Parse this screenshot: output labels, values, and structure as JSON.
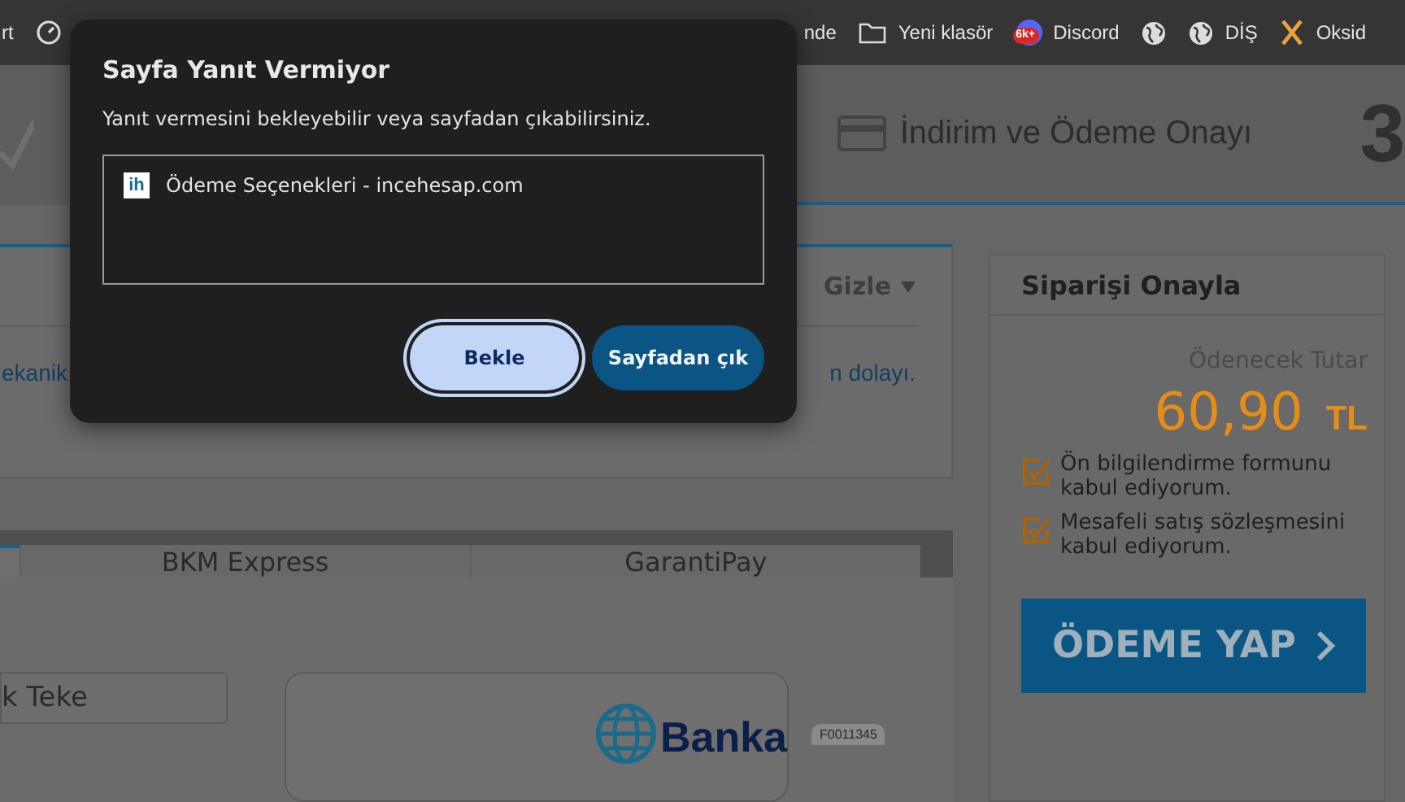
{
  "bookmarks_bar": {
    "items": [
      {
        "kind": "text",
        "label": "rt"
      },
      {
        "kind": "gauge"
      },
      {
        "kind": "text",
        "label": "nde"
      },
      {
        "kind": "folder",
        "label": "Yeni klasör"
      },
      {
        "kind": "discord",
        "label": "Discord",
        "badge": "6k+"
      },
      {
        "kind": "globe"
      },
      {
        "kind": "globe",
        "label": "DİŞ"
      },
      {
        "kind": "cross",
        "label": "Oksid"
      }
    ]
  },
  "step_header": {
    "label": "İndirim ve Ödeme Onayı",
    "number": "3"
  },
  "info_panel": {
    "toggle": "Gizle",
    "text_left": "ekanik",
    "text_right": "n dolayı."
  },
  "payment_tabs": [
    {
      "selected": true
    },
    {
      "label": "BKM Express",
      "selected": false
    },
    {
      "label": "GarantiPay",
      "selected": false
    }
  ],
  "name_field": {
    "value": "k Teke"
  },
  "card_image": {
    "brand": "Banka",
    "serial": "F0011345"
  },
  "order_summary": {
    "title": "Siparişi Onayla",
    "amount_label": "Ödenecek Tutar",
    "amount": "60,90",
    "currency": "TL",
    "agreements": [
      {
        "label": "Ön bilgilendirme formunu kabul ediyorum.",
        "checked": true
      },
      {
        "label": "Mesafeli satış sözleşmesini kabul ediyorum.",
        "checked": true
      }
    ],
    "pay_button": "ÖDEME YAP"
  },
  "dialog": {
    "title": "Sayfa Yanıt Vermiyor",
    "message": "Yanıt vermesini bekleyebilir veya sayfadan çıkabilirsiniz.",
    "page": {
      "favicon": "ih",
      "title": "Ödeme Seçenekleri - incehesap.com"
    },
    "buttons": [
      {
        "label": "Bekle",
        "kind": "secondary",
        "focused": true
      },
      {
        "label": "Sayfadan çık",
        "kind": "primary",
        "focused": false
      }
    ]
  }
}
